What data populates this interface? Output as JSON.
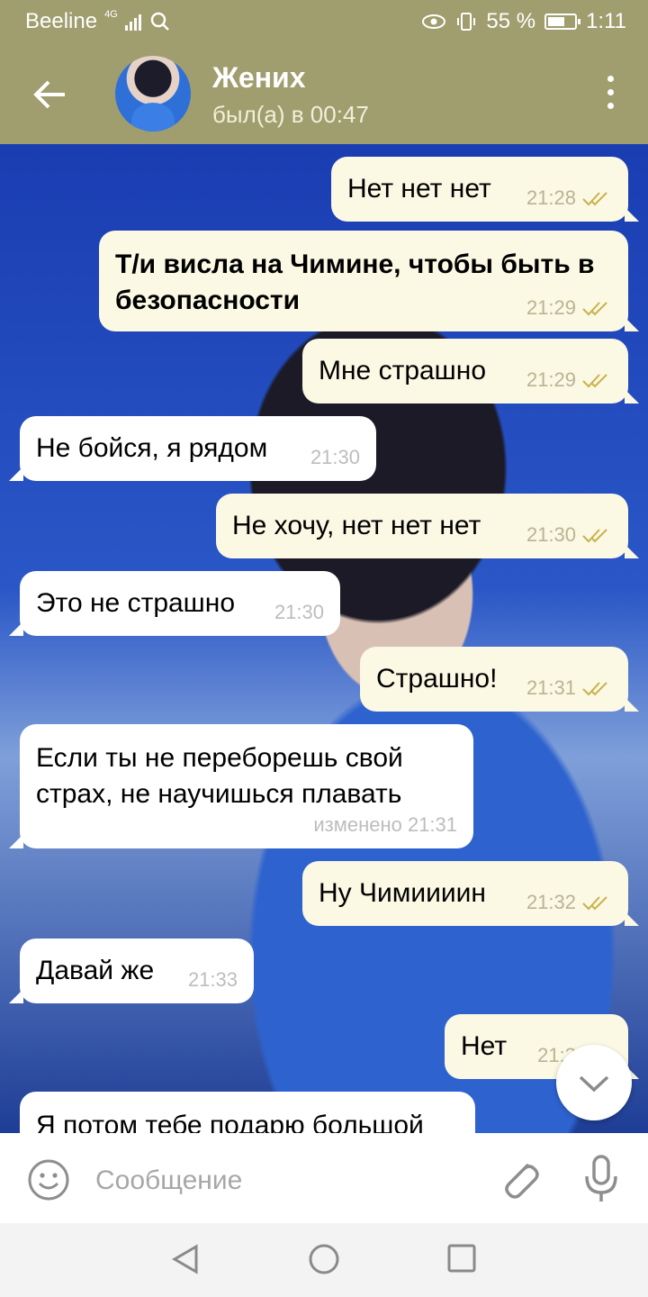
{
  "status_bar": {
    "carrier": "Beeline",
    "network": "4G",
    "battery": "55 %",
    "time": "1:11"
  },
  "header": {
    "contact_name": "Жених",
    "last_seen": "был(а) в 00:47"
  },
  "messages": [
    {
      "dir": "out",
      "text": "Нет нет нет",
      "time": "21:28",
      "ticks": true
    },
    {
      "dir": "out",
      "text": "Т/и висла на Чимине, чтобы быть в безопасности",
      "time": "21:29",
      "ticks": true,
      "bold": true
    },
    {
      "dir": "out",
      "text": "Мне страшно",
      "time": "21:29",
      "ticks": true
    },
    {
      "dir": "in",
      "text": "Не бойся, я рядом",
      "time": "21:30"
    },
    {
      "dir": "out",
      "text": "Не хочу, нет нет нет",
      "time": "21:30",
      "ticks": true
    },
    {
      "dir": "in",
      "text": "Это не страшно",
      "time": "21:30"
    },
    {
      "dir": "out",
      "text": "Страшно!",
      "time": "21:31",
      "ticks": true
    },
    {
      "dir": "in",
      "text": "Если ты не переборешь свой страх, не научишься плавать",
      "time": "изменено 21:31"
    },
    {
      "dir": "out",
      "text": "Ну Чимиииин",
      "time": "21:32",
      "ticks": true
    },
    {
      "dir": "in",
      "text": "Давай же",
      "time": "21:33"
    },
    {
      "dir": "out",
      "text": "Нет",
      "time": "21:3",
      "ticks": true
    },
    {
      "dir": "in",
      "text": "Я потом тебе подарю большой",
      "time": ""
    }
  ],
  "input": {
    "placeholder": "Сообщение"
  },
  "icons": {
    "back": "arrow-left-icon",
    "menu": "kebab-menu-icon",
    "emoji": "smile-icon",
    "attach": "paperclip-icon",
    "mic": "microphone-icon",
    "scroll": "chevron-down-icon"
  },
  "colors": {
    "header": "#a09d6f",
    "outgoing_bubble": "#fbf8e4",
    "incoming_bubble": "#ffffff"
  }
}
